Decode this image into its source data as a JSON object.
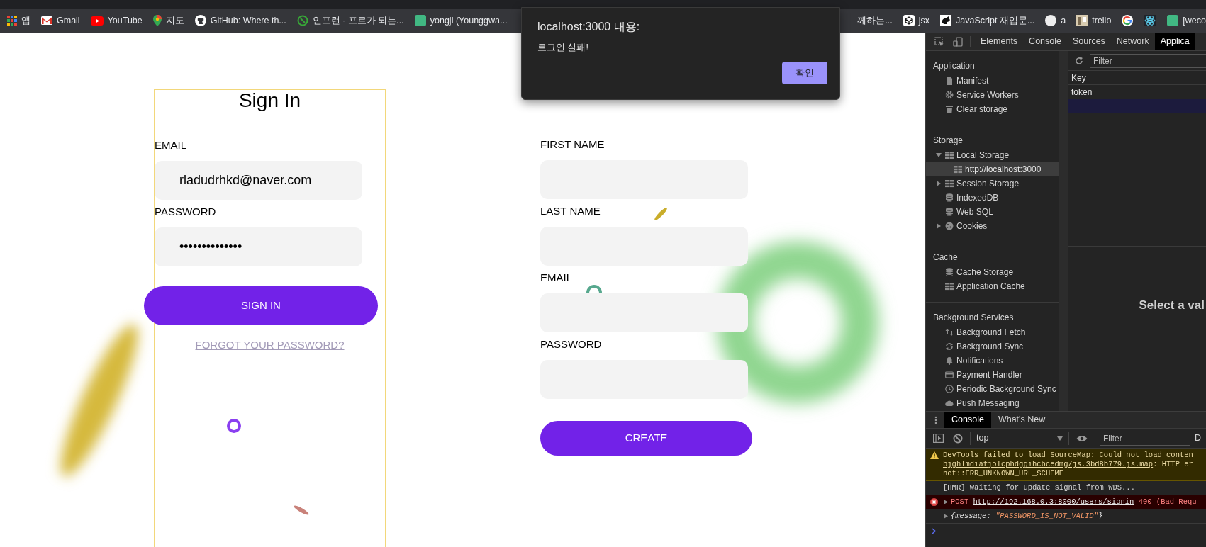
{
  "bookmarks_bar": {
    "left_items": [
      {
        "kind": "apps",
        "label": "앱"
      },
      {
        "kind": "gmail",
        "label": "Gmail"
      },
      {
        "kind": "youtube",
        "label": "YouTube"
      },
      {
        "kind": "maps",
        "label": "지도"
      },
      {
        "kind": "github",
        "label": "GitHub: Where th..."
      },
      {
        "kind": "inflearn",
        "label": "인프런 - 프로가 되는..."
      },
      {
        "kind": "vsquare",
        "label": "yongjl (Younggwa..."
      }
    ],
    "right_items": [
      {
        "kind": "none",
        "label": "께하는..."
      },
      {
        "kind": "cube",
        "label": "jsx"
      },
      {
        "kind": "animal",
        "label": "JavaScript 재입문..."
      },
      {
        "kind": "dot",
        "label": "a"
      },
      {
        "kind": "thumb",
        "label": "trello"
      },
      {
        "kind": "google"
      },
      {
        "kind": "atom"
      },
      {
        "kind": "vsquare",
        "label": "[weco"
      }
    ]
  },
  "sign_in": {
    "title": "Sign In",
    "fields": [
      {
        "label": "EMAIL",
        "value": "rladudrhkd@naver.com"
      },
      {
        "label": "PASSWORD",
        "value": "••••••••••••••"
      }
    ],
    "button": "SIGN IN",
    "link": "FORGOT YOUR PASSWORD?"
  },
  "register": {
    "fields": [
      {
        "label": "FIRST NAME"
      },
      {
        "label": "LAST NAME"
      },
      {
        "label": "EMAIL"
      },
      {
        "label": "PASSWORD"
      }
    ],
    "button": "CREATE"
  },
  "dialog": {
    "title": "localhost:3000 내용:",
    "message": "로그인 실패!",
    "button": "확인"
  },
  "devtools": {
    "tabs": [
      {
        "label": "Elements",
        "selected": false
      },
      {
        "label": "Console",
        "selected": false
      },
      {
        "label": "Sources",
        "selected": false
      },
      {
        "label": "Network",
        "selected": false
      },
      {
        "label": "Applica",
        "selected": true
      }
    ],
    "sidebar": {
      "sections": [
        {
          "title": "Application",
          "items": [
            {
              "label": "Manifest",
              "kind": "file",
              "selected": false
            },
            {
              "label": "Service Workers",
              "kind": "gear",
              "selected": false
            },
            {
              "label": "Clear storage",
              "kind": "trash",
              "selected": false
            }
          ]
        },
        {
          "title": "Storage",
          "items": [
            {
              "label": "Local Storage",
              "kind": "table",
              "selected": false,
              "expanded": true,
              "children": [
                {
                  "label": "http://localhost:3000",
                  "kind": "table",
                  "selected": true
                }
              ]
            },
            {
              "label": "Session Storage",
              "kind": "table",
              "selected": false,
              "expanded": false
            },
            {
              "label": "IndexedDB",
              "kind": "database",
              "selected": false
            },
            {
              "label": "Web SQL",
              "kind": "database",
              "selected": false
            },
            {
              "label": "Cookies",
              "kind": "cookie",
              "selected": false,
              "expanded": false
            }
          ]
        },
        {
          "title": "Cache",
          "items": [
            {
              "label": "Cache Storage",
              "kind": "database",
              "selected": false
            },
            {
              "label": "Application Cache",
              "kind": "table",
              "selected": false
            }
          ]
        },
        {
          "title": "Background Services",
          "items": [
            {
              "label": "Background Fetch",
              "kind": "arrows",
              "selected": false
            },
            {
              "label": "Background Sync",
              "kind": "sync",
              "selected": false
            },
            {
              "label": "Notifications",
              "kind": "bell",
              "selected": false
            },
            {
              "label": "Payment Handler",
              "kind": "card",
              "selected": false
            },
            {
              "label": "Periodic Background Sync",
              "kind": "clock",
              "selected": false
            },
            {
              "label": "Push Messaging",
              "kind": "cloud",
              "selected": false
            }
          ]
        }
      ]
    },
    "storage_view": {
      "filter_placeholder": "Filter",
      "columns": [
        "Key"
      ],
      "rows": [
        {
          "key": "token",
          "selected": false
        },
        {
          "selected": true
        }
      ],
      "preview_message": "Select a val"
    },
    "console_drawer": {
      "tabs": [
        {
          "label": "Console",
          "selected": true
        },
        {
          "label": "What's New",
          "selected": false
        }
      ],
      "context": "top",
      "filter_placeholder": "Filter",
      "levels_button": "D",
      "messages": [
        {
          "kind": "warning",
          "text": "DevTools failed to load SourceMap: Could not load conten",
          "link": "bjghlmdiafjolcphdggihcbcedmg/js.3bd8b779.js.map",
          "link_suffix": ": HTTP er",
          "detail": "net::ERR_UNKNOWN_URL_SCHEME"
        },
        {
          "kind": "log",
          "text": "[HMR] Waiting for update signal from WDS..."
        },
        {
          "kind": "error",
          "method": "POST",
          "link": "http://192.168.0.3:8000/users/signin",
          "link_suffix": "400 (Bad Requ",
          "expanded": false
        },
        {
          "kind": "object",
          "text_before": "{message: ",
          "value": "\"PASSWORD_IS_NOT_VALID\"",
          "text_after": "}",
          "expanded": false
        }
      ]
    }
  }
}
